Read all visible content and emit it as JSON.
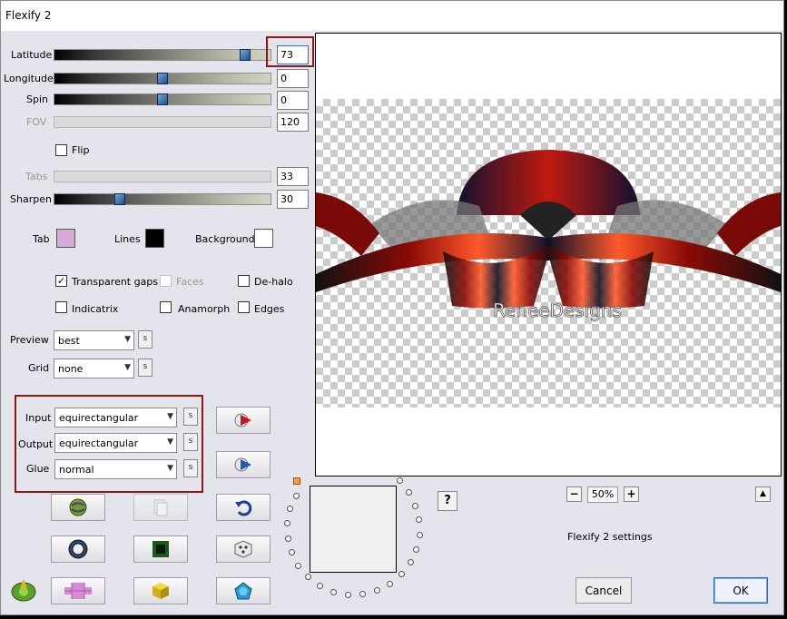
{
  "window": {
    "title": "Flexify 2"
  },
  "params": {
    "latitude": {
      "label": "Latitude",
      "value": "73",
      "fraction": 0.87
    },
    "longitude": {
      "label": "Longitude",
      "value": "0",
      "fraction": 0.5
    },
    "spin": {
      "label": "Spin",
      "value": "0",
      "fraction": 0.5
    },
    "fov": {
      "label": "FOV",
      "value": "120"
    },
    "flip": {
      "label": "Flip",
      "checked": false
    },
    "tabs": {
      "label": "Tabs",
      "value": "33"
    },
    "sharpen": {
      "label": "Sharpen",
      "value": "30",
      "fraction": 0.3
    }
  },
  "colors": {
    "tab": {
      "label": "Tab",
      "color": "#d8a8d8"
    },
    "lines": {
      "label": "Lines",
      "color": "#000000"
    },
    "background": {
      "label": "Background",
      "color": "#ffffff"
    }
  },
  "options": {
    "transparent_gaps": {
      "label": "Transparent gaps",
      "checked": true
    },
    "faces": {
      "label": "Faces",
      "checked": false
    },
    "dehalo": {
      "label": "De-halo",
      "checked": false
    },
    "indicatrix": {
      "label": "Indicatrix",
      "checked": false
    },
    "anamorph": {
      "label": "Anamorph",
      "checked": false
    },
    "edges": {
      "label": "Edges",
      "checked": false
    }
  },
  "preview_opts": {
    "label": "Preview",
    "value": "best",
    "s": "s"
  },
  "grid_opts": {
    "label": "Grid",
    "value": "none",
    "s": "s"
  },
  "projection": {
    "input": {
      "label": "Input",
      "value": "equirectangular",
      "s": "s"
    },
    "output": {
      "label": "Output",
      "value": "equirectangular",
      "s": "s"
    },
    "glue": {
      "label": "Glue",
      "value": "normal",
      "s": "s"
    }
  },
  "preview": {
    "watermark": "ReneeDesigns"
  },
  "zoom": {
    "minus": "−",
    "value": "50%",
    "plus": "+",
    "collapse": "▲"
  },
  "help": {
    "label": "?"
  },
  "settings_label": "Flexify 2 settings",
  "buttons": {
    "cancel": "Cancel",
    "ok": "OK"
  },
  "accent": {
    "highlight": "#8b1a10",
    "default_button": "#2a6ac7"
  }
}
